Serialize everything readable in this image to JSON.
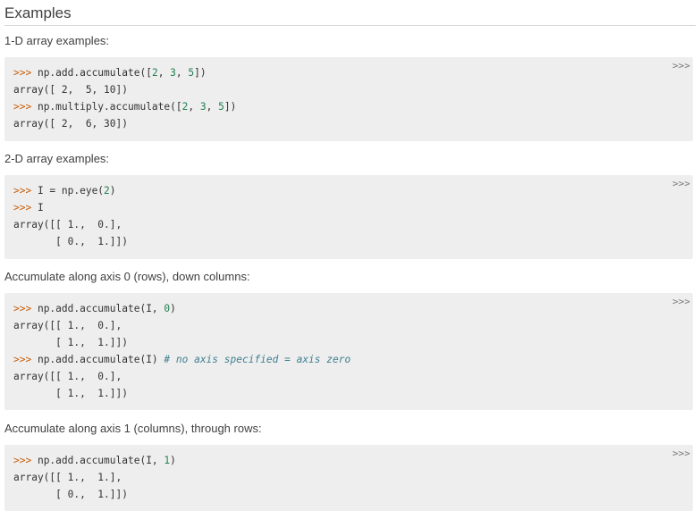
{
  "heading": "Examples",
  "sections": [
    {
      "text": "1-D array examples:",
      "copy_label": ">>>",
      "lines": [
        {
          "prompt": ">>> ",
          "segments": [
            [
              "np.add.accumulate([",
              ""
            ],
            [
              "2",
              "n"
            ],
            [
              ", ",
              ""
            ],
            [
              "3",
              "n"
            ],
            [
              ", ",
              ""
            ],
            [
              "5",
              "n"
            ],
            [
              "])",
              ""
            ]
          ]
        },
        {
          "prompt": "",
          "segments": [
            [
              "array([ 2,  5, 10])",
              ""
            ]
          ]
        },
        {
          "prompt": ">>> ",
          "segments": [
            [
              "np.multiply.accumulate([",
              ""
            ],
            [
              "2",
              "n"
            ],
            [
              ", ",
              ""
            ],
            [
              "3",
              "n"
            ],
            [
              ", ",
              ""
            ],
            [
              "5",
              "n"
            ],
            [
              "])",
              ""
            ]
          ]
        },
        {
          "prompt": "",
          "segments": [
            [
              "array([ 2,  6, 30])",
              ""
            ]
          ]
        }
      ]
    },
    {
      "text": "2-D array examples:",
      "copy_label": ">>>",
      "lines": [
        {
          "prompt": ">>> ",
          "segments": [
            [
              "I = np.eye(",
              ""
            ],
            [
              "2",
              "n"
            ],
            [
              ")",
              ""
            ]
          ]
        },
        {
          "prompt": ">>> ",
          "segments": [
            [
              "I",
              ""
            ]
          ]
        },
        {
          "prompt": "",
          "segments": [
            [
              "array([[ 1.,  0.],",
              ""
            ]
          ]
        },
        {
          "prompt": "",
          "segments": [
            [
              "       [ 0.,  1.]])",
              ""
            ]
          ]
        }
      ]
    },
    {
      "text": "Accumulate along axis 0 (rows), down columns:",
      "copy_label": ">>>",
      "lines": [
        {
          "prompt": ">>> ",
          "segments": [
            [
              "np.add.accumulate(I, ",
              ""
            ],
            [
              "0",
              "n"
            ],
            [
              ")",
              ""
            ]
          ]
        },
        {
          "prompt": "",
          "segments": [
            [
              "array([[ 1.,  0.],",
              ""
            ]
          ]
        },
        {
          "prompt": "",
          "segments": [
            [
              "       [ 1.,  1.]])",
              ""
            ]
          ]
        },
        {
          "prompt": ">>> ",
          "segments": [
            [
              "np.add.accumulate(I) ",
              ""
            ],
            [
              "# no axis specified = axis zero",
              "c"
            ]
          ]
        },
        {
          "prompt": "",
          "segments": [
            [
              "array([[ 1.,  0.],",
              ""
            ]
          ]
        },
        {
          "prompt": "",
          "segments": [
            [
              "       [ 1.,  1.]])",
              ""
            ]
          ]
        }
      ]
    },
    {
      "text": "Accumulate along axis 1 (columns), through rows:",
      "copy_label": ">>>",
      "lines": [
        {
          "prompt": ">>> ",
          "segments": [
            [
              "np.add.accumulate(I, ",
              ""
            ],
            [
              "1",
              "n"
            ],
            [
              ")",
              ""
            ]
          ]
        },
        {
          "prompt": "",
          "segments": [
            [
              "array([[ 1.,  1.],",
              ""
            ]
          ]
        },
        {
          "prompt": "",
          "segments": [
            [
              "       [ 0.,  1.]])",
              ""
            ]
          ]
        }
      ]
    }
  ]
}
